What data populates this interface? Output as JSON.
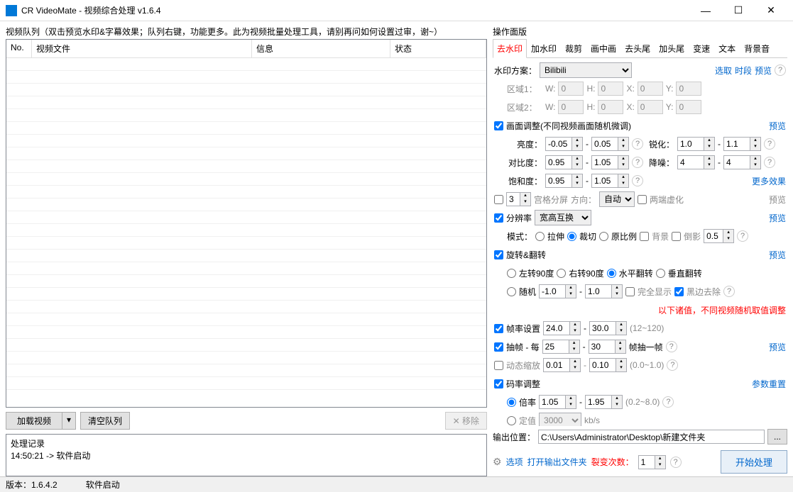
{
  "titlebar": {
    "title": "CR VideoMate - 视频综合处理 v1.6.4"
  },
  "left": {
    "group_label": "视频队列（双击预览水印&字幕效果；队列右键，功能更多。此为视频批量处理工具，请别再问如何设置过审，谢~）",
    "cols": {
      "no": "No.",
      "file": "视频文件",
      "info": "信息",
      "status": "状态"
    },
    "load_btn": "加载视频",
    "clear_btn": "清空队列",
    "remove_btn": "✕ 移除",
    "log_title": "处理记录",
    "log_line": "14:50:21 -> 软件启动"
  },
  "right": {
    "group_label": "操作面版",
    "tabs": [
      "去水印",
      "加水印",
      "裁剪",
      "画中画",
      "去头尾",
      "加头尾",
      "变速",
      "文本",
      "背景音"
    ],
    "watermark": {
      "label": "水印方案：",
      "select": "Bilibili",
      "action_select": "选取",
      "action_time": "时段",
      "action_preview": "预览",
      "area1": "区域1：",
      "area2": "区域2：",
      "w": "W:",
      "h": "H:",
      "x": "X:",
      "y": "Y:",
      "w1": "0",
      "h1": "0",
      "x1": "0",
      "y1": "0",
      "w2": "0",
      "h2": "0",
      "x2": "0",
      "y2": "0"
    },
    "frame_adj": {
      "title": "画面调整(不同视频画面随机微调)",
      "preview": "预览",
      "brightness": "亮度：",
      "b1": "-0.05",
      "b2": "0.05",
      "sharpen": "锐化：",
      "s1": "1.0",
      "s2": "1.1",
      "contrast": "对比度：",
      "c1": "0.95",
      "c2": "1.05",
      "denoise": "降噪：",
      "d1": "4",
      "d2": "4",
      "saturation": "饱和度：",
      "sa1": "0.95",
      "sa2": "1.05",
      "more": "更多效果"
    },
    "grid": {
      "val": "3",
      "label": "宫格分屏",
      "dir": "方向：",
      "dir_sel": "自动",
      "both": "两端虚化",
      "preview": "预览"
    },
    "res": {
      "title": "分辨率",
      "sel": "宽高互换",
      "preview": "预览",
      "mode": "模式：",
      "stretch": "拉伸",
      "crop": "裁切",
      "keep": "原比例",
      "bg": "背景",
      "mirror": "倒影",
      "mirror_v": "0.5"
    },
    "rotate": {
      "title": "旋转&翻转",
      "preview": "预览",
      "l90": "左转90度",
      "r90": "右转90度",
      "hflip": "水平翻转",
      "vflip": "垂直翻转",
      "rand": "随机",
      "r1": "-1.0",
      "r2": "1.0",
      "full": "完全显示",
      "black": "黑边去除"
    },
    "note": "以下诸值，不同视频随机取值调整",
    "fps": {
      "title": "帧率设置",
      "v1": "24.0",
      "v2": "30.0",
      "hint": "(12~120)"
    },
    "drop": {
      "title": "抽帧 - 每",
      "v1": "25",
      "v2": "30",
      "hint": "帧抽一帧",
      "preview": "预览"
    },
    "scale": {
      "title": "动态缩放",
      "v1": "0.01",
      "v2": "0.10",
      "hint": "(0.0~1.0)"
    },
    "bitrate": {
      "title": "码率调整",
      "reset": "参数重置",
      "ratio": "倍率",
      "r1": "1.05",
      "r2": "1.95",
      "rhint": "(0.2~8.0)",
      "fixed": "定值",
      "fv": "3000",
      "unit": "kb/s"
    },
    "output": {
      "label": "输出位置：",
      "path": "C:\\Users\\Administrator\\Desktop\\新建文件夹",
      "browse": "..."
    },
    "actions": {
      "options": "选项",
      "open": "打开输出文件夹",
      "split_label": "裂变次数：",
      "split_v": "1",
      "start": "开始处理"
    }
  },
  "footer": {
    "version_label": "版本：",
    "version": "1.6.4.2",
    "status": "软件启动"
  }
}
